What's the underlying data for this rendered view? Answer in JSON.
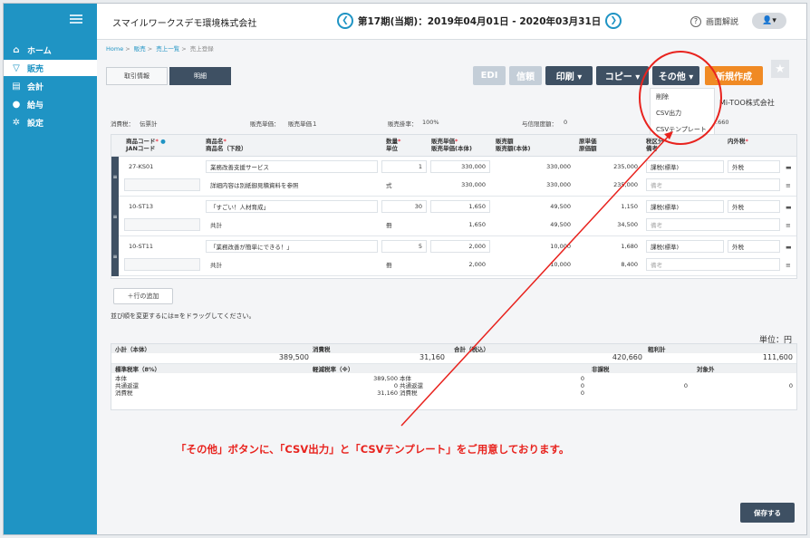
{
  "sidebar": {
    "items": [
      {
        "icon": "home-icon",
        "glyph": "⌂",
        "label": "ホーム"
      },
      {
        "icon": "cart-icon",
        "glyph": "🛒",
        "label": "販売"
      },
      {
        "icon": "ledger-icon",
        "glyph": "▤",
        "label": "会計"
      },
      {
        "icon": "moneybag-icon",
        "glyph": "●",
        "label": "給与"
      },
      {
        "icon": "gear-icon",
        "glyph": "✲",
        "label": "設定"
      }
    ]
  },
  "header": {
    "company": "スマイルワークスデモ環境株式会社",
    "period": "第17期(当期)：2019年04月01日 - 2020年03月31日",
    "help": "画面解説"
  },
  "breadcrumb": [
    "Home",
    "販売",
    "売上一覧",
    "売上登録"
  ],
  "tabs": [
    "取引情報",
    "明細"
  ],
  "toolbar": {
    "edi": "EDI",
    "sign": "信頼",
    "print": "印刷 ▾",
    "copy": "コピー ▾",
    "other": "その他 ▾",
    "new": "新規作成"
  },
  "dropdown": [
    "削除",
    "CSV出力",
    "CSVテンプレート"
  ],
  "partner": "Mi-TOO株式会社",
  "meta": {
    "tax_label": "消費税：",
    "tax_value": "伝票計",
    "unit_price_label": "販売単価：",
    "unit_price_value": "販売単価１",
    "rate_label": "販売掛率：",
    "rate_value": "100%",
    "credit_label": "与信限度額：",
    "credit_value": "0",
    "right_value": ".660"
  },
  "table": {
    "headers": [
      [
        "商品コード",
        "JANコード"
      ],
      [
        "商品名",
        "商品名（下段）"
      ],
      [
        "数量",
        "単位"
      ],
      [
        "販売単価",
        "販売単価(本体)"
      ],
      [
        "販売額",
        "販売額(本体)"
      ],
      [
        "原単価",
        "原価額"
      ],
      [
        "税区分",
        "備考"
      ],
      [
        "内外税"
      ]
    ],
    "rows": [
      {
        "code": "27-KS01",
        "name": "業務改善支援サービス",
        "qty": "1",
        "unit_price": "330,000",
        "amount": "330,000",
        "cost": "235,000",
        "tax": "課税(標準)",
        "inout": "外税",
        "jan": "",
        "sub": "詳細内容は別紙御見積資料を参照",
        "unit": "式",
        "unit_price_net": "330,000",
        "amount_net": "330,000",
        "cost_total": "235,000",
        "note": "備考"
      },
      {
        "code": "10-ST13",
        "name": "「すごい！人材育成」",
        "qty": "30",
        "unit_price": "1,650",
        "amount": "49,500",
        "cost": "1,150",
        "tax": "課税(標準)",
        "inout": "外税",
        "jan": "",
        "sub": "共計",
        "unit": "冊",
        "unit_price_net": "1,650",
        "amount_net": "49,500",
        "cost_total": "34,500",
        "note": "備考"
      },
      {
        "code": "10-ST11",
        "name": "「業務改善が簡単にできる！」",
        "qty": "5",
        "unit_price": "2,000",
        "amount": "10,000",
        "cost": "1,680",
        "tax": "課税(標準)",
        "inout": "外税",
        "jan": "",
        "sub": "共計",
        "unit": "冊",
        "unit_price_net": "2,000",
        "amount_net": "10,000",
        "cost_total": "8,400",
        "note": "備考"
      }
    ]
  },
  "add_row": "＋行の追加",
  "drag_note": "並び順を変更するには≡をドラッグしてください。",
  "unit_note": "単位：円",
  "summary": {
    "subtotal_label": "小計（本体）",
    "subtotal": "389,500",
    "tax_label": "消費税",
    "tax": "31,160",
    "total_label": "合計（税込）",
    "total": "420,660",
    "gross_label": "粗利計",
    "gross": "111,600",
    "std_label": "標準税率（8%）",
    "std_lines": [
      "本体",
      "共通返還",
      "消費税"
    ],
    "std_values": [
      "389,500",
      "0",
      "31,160"
    ],
    "red_label": "軽減税率（※）",
    "red_lines": [
      "本体",
      "共通返還",
      "消費税"
    ],
    "red_values": [
      "0",
      "0",
      "0"
    ],
    "nontax_label": "非課税",
    "nontax": "0",
    "exempt_label": "対象外",
    "exempt": "0"
  },
  "annotation": "「その他」ボタンに、「CSV出力」と「CSVテンプレート」をご用意しております。",
  "save": "保存する",
  "colors": {
    "sidebar": "#1f94c4",
    "navy": "#3e5063",
    "orange": "#f08a24",
    "annotation": "#e8231e"
  }
}
